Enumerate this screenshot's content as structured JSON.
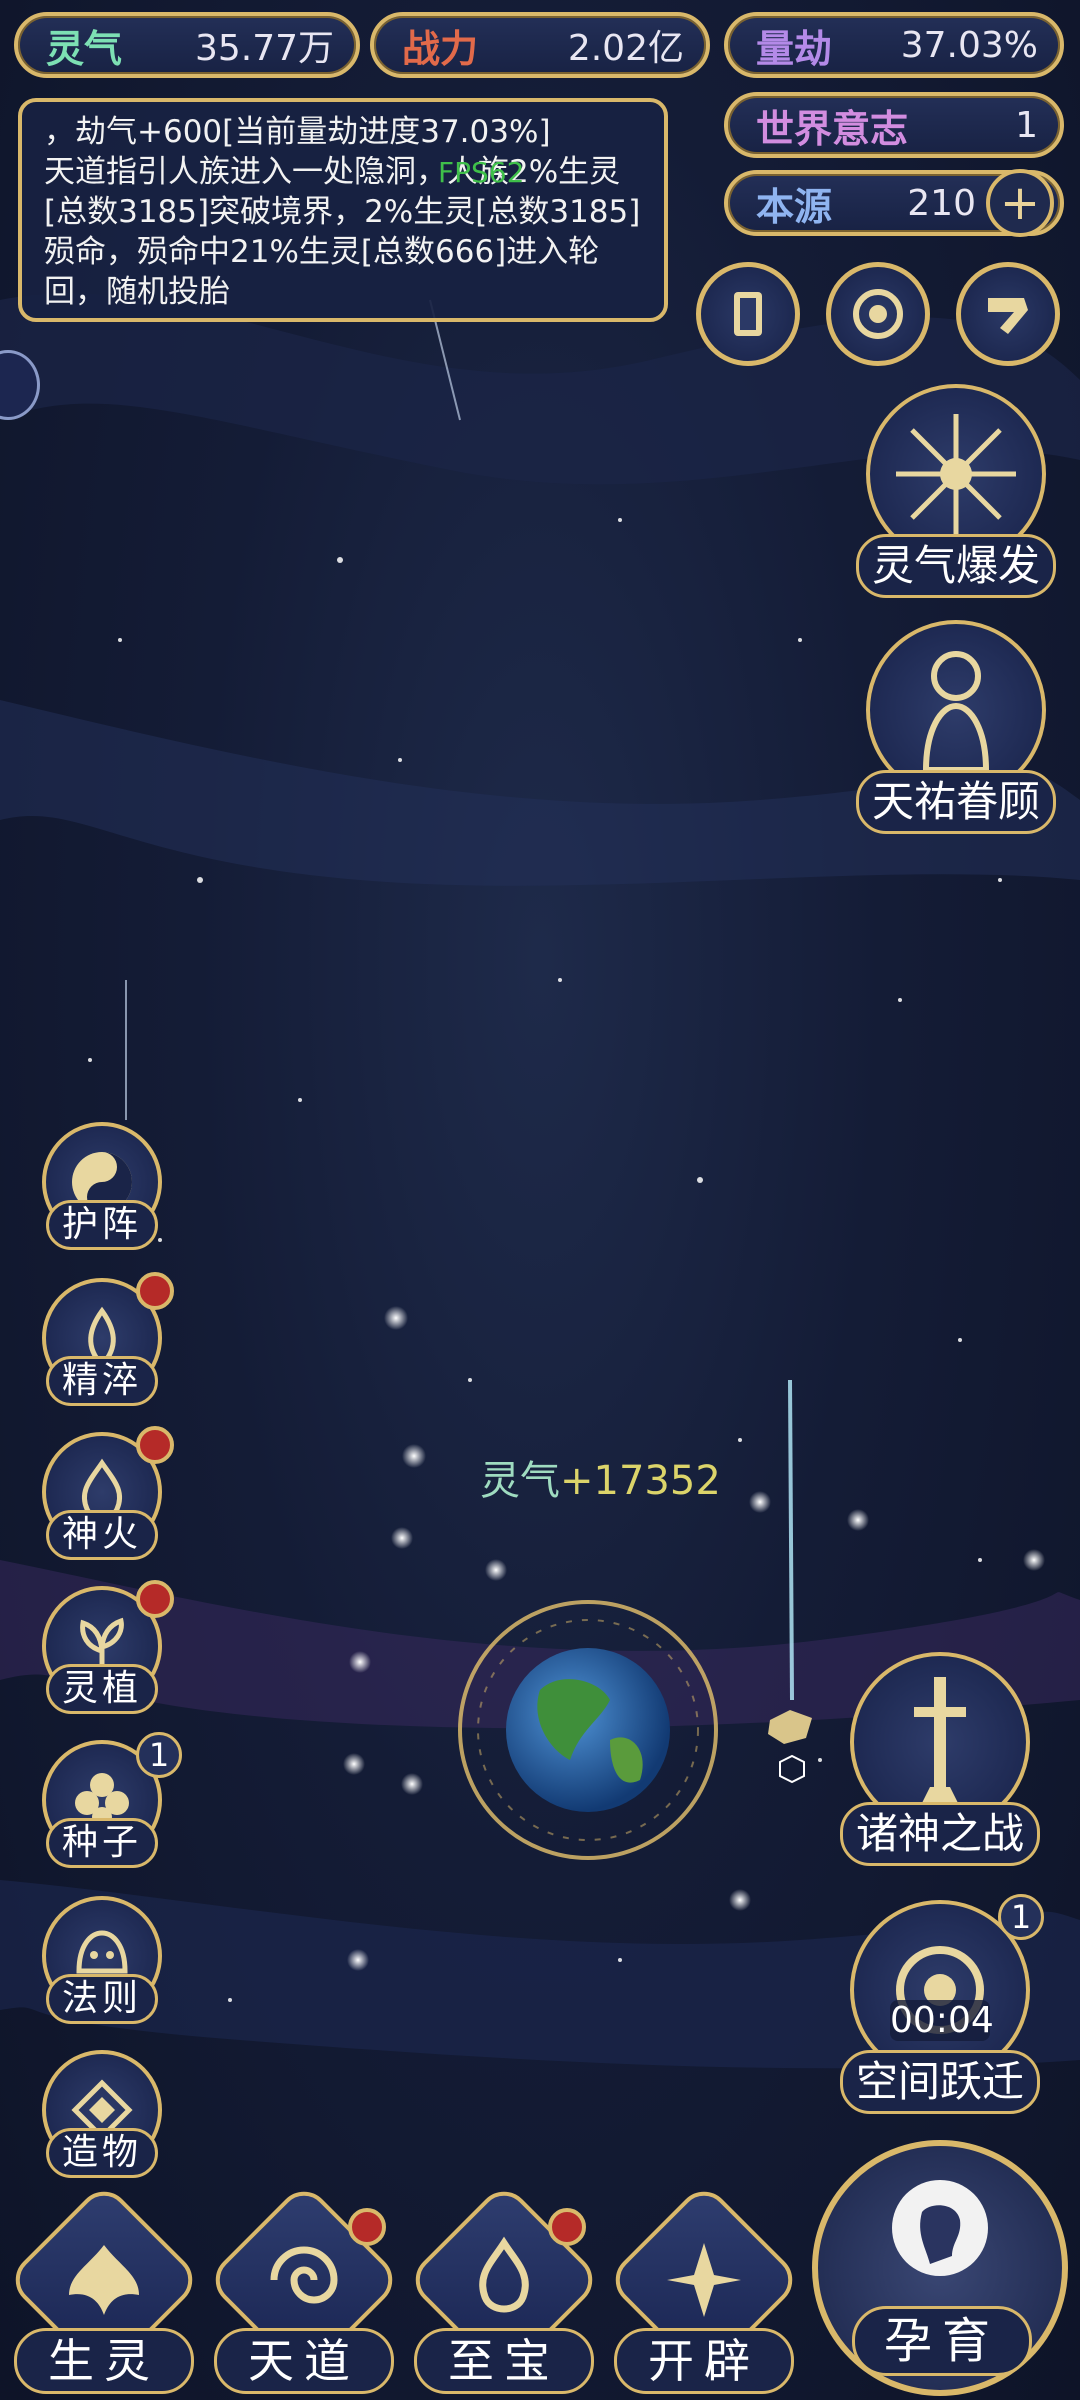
{
  "top_bar": {
    "lingqi": {
      "label": "灵气",
      "value": "35.77万"
    },
    "zhanli": {
      "label": "战力",
      "value": "2.02亿"
    },
    "liangjie": {
      "label": "量劫",
      "value": "37.03%"
    },
    "shijie_yizhi": {
      "label": "世界意志",
      "value": "1"
    },
    "benyuan": {
      "label": "本源",
      "value": "210"
    }
  },
  "log": {
    "line1": "，劫气+600[当前量劫进度37.03%]",
    "line2": "天道指引人族进入一处隐洞，人族2%生灵[总数3185]突破境界，2%生灵[总数3185]殒命，殒命中21%生灵[总数666]进入轮回，随机投胎",
    "fps": "FPS62"
  },
  "right_panel": {
    "burst_label": "灵气爆发",
    "blessing_label": "天祐眷顾",
    "war_label": "诸神之战",
    "jump_label": "空间跃迁",
    "jump_timer": "00:04",
    "jump_badge": "1"
  },
  "left_menu": {
    "items": [
      {
        "label": "护阵"
      },
      {
        "label": "精淬"
      },
      {
        "label": "神火"
      },
      {
        "label": "灵植"
      },
      {
        "label": "种子",
        "badge": "1"
      },
      {
        "label": "法则"
      },
      {
        "label": "造物"
      }
    ]
  },
  "float_gain": {
    "label": "灵气",
    "value": "+17352"
  },
  "bottom_nav": {
    "shengling": "生灵",
    "tiandao": "天道",
    "zhibao": "至宝",
    "kaipi": "开辟",
    "yunyu": "孕育"
  },
  "colors": {
    "gold": "#d9b86a",
    "lingqi_label": "#7de0b4",
    "zhanli_label": "#e26a4a",
    "liangjie_label": "#b48ae8",
    "shijie_label": "#d28de0",
    "benyuan_label": "#8fb4f0",
    "badge_red": "#b52a28"
  }
}
